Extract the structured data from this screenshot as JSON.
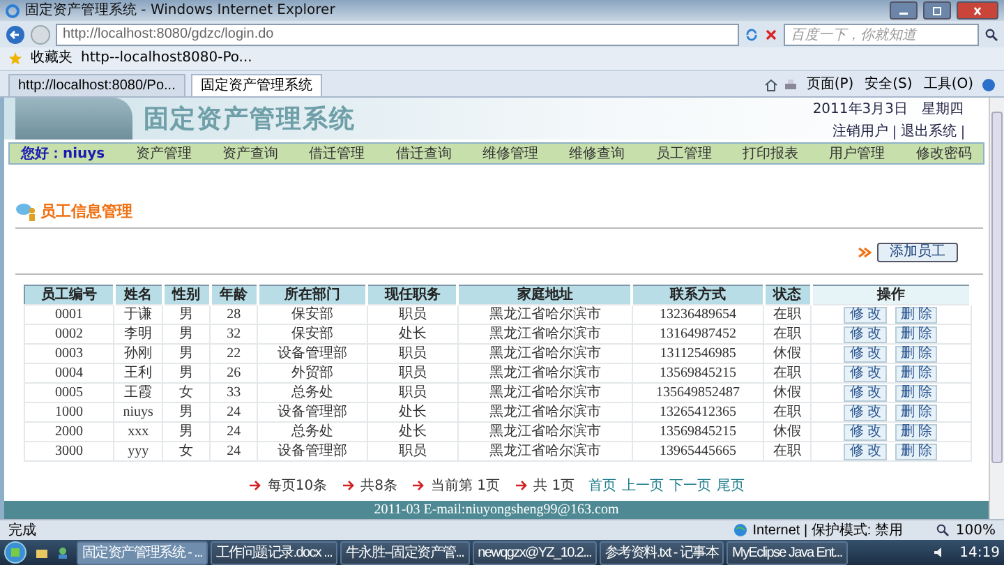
{
  "browser": {
    "title": "固定资产管理系统 - Windows Internet Explorer",
    "address": "http://localhost:8080/gdzc/login.do",
    "search_placeholder": "百度一下，你就知道",
    "favorites_label": "收藏夹",
    "favorite_link": "http--localhost8080-Po...",
    "tabs": [
      {
        "label": "http://localhost:8080/Po...",
        "selected": false
      },
      {
        "label": "固定资产管理系统",
        "selected": true
      }
    ],
    "commands": [
      "页面(P)",
      "安全(S)",
      "工具(O)"
    ]
  },
  "header": {
    "title": "固定资产管理系统",
    "date": "2011年3月3日",
    "weekday": "星期四",
    "links": [
      "注销用户",
      "退出系统"
    ]
  },
  "nav": {
    "greeting": "您好：",
    "user": "niuys",
    "items": [
      "资产管理",
      "资产查询",
      "借迁管理",
      "借迁查询",
      "维修管理",
      "维修查询",
      "员工管理",
      "打印报表",
      "用户管理",
      "修改密码"
    ]
  },
  "section_title": "员工信息管理",
  "add_button": "添加员工",
  "table": {
    "columns": [
      "员工编号",
      "姓名",
      "性别",
      "年龄",
      "所在部门",
      "现任职务",
      "家庭地址",
      "联系方式",
      "状态",
      "操作"
    ],
    "rows": [
      {
        "cells": [
          "0001",
          "于谦",
          "男",
          "28",
          "保安部",
          "职员",
          "黑龙江省哈尔滨市",
          "13236489654",
          "在职"
        ],
        "actions": [
          "修 改",
          "删 除"
        ]
      },
      {
        "cells": [
          "0002",
          "李明",
          "男",
          "32",
          "保安部",
          "处长",
          "黑龙江省哈尔滨市",
          "13164987452",
          "在职"
        ],
        "actions": [
          "修 改",
          "删 除"
        ]
      },
      {
        "cells": [
          "0003",
          "孙刚",
          "男",
          "22",
          "设备管理部",
          "职员",
          "黑龙江省哈尔滨市",
          "13112546985",
          "休假"
        ],
        "actions": [
          "修 改",
          "删 除"
        ]
      },
      {
        "cells": [
          "0004",
          "王利",
          "男",
          "26",
          "外贸部",
          "职员",
          "黑龙江省哈尔滨市",
          "13569845215",
          "在职"
        ],
        "actions": [
          "修 改",
          "删 除"
        ]
      },
      {
        "cells": [
          "0005",
          "王霞",
          "女",
          "33",
          "总务处",
          "职员",
          "黑龙江省哈尔滨市",
          "135649852487",
          "休假"
        ],
        "actions": [
          "修 改",
          "删 除"
        ]
      },
      {
        "cells": [
          "1000",
          "niuys",
          "男",
          "24",
          "设备管理部",
          "处长",
          "黑龙江省哈尔滨市",
          "13265412365",
          "在职"
        ],
        "actions": [
          "修 改",
          "删 除"
        ]
      },
      {
        "cells": [
          "2000",
          "xxx",
          "男",
          "24",
          "总务处",
          "处长",
          "黑龙江省哈尔滨市",
          "13569845215",
          "休假"
        ],
        "actions": [
          "修 改",
          "删 除"
        ]
      },
      {
        "cells": [
          "3000",
          "yyy",
          "女",
          "24",
          "设备管理部",
          "职员",
          "黑龙江省哈尔滨市",
          "13965445665",
          "在职"
        ],
        "actions": [
          "修 改",
          "删 除"
        ]
      }
    ]
  },
  "pager": {
    "info": [
      "每页10条",
      "共8条",
      "当前第 1页",
      "共 1页"
    ],
    "links": [
      "首页",
      "上一页",
      "下一页",
      "尾页"
    ]
  },
  "footer": "2011-03 E-mail:niuyongsheng99@163.com",
  "status": {
    "text": "完成",
    "zone": "Internet | 保护模式: 禁用",
    "zoom": "100%"
  },
  "taskbar": {
    "apps": [
      {
        "label": "固定资产管理系统 - ...",
        "selected": true
      },
      {
        "label": "工作问题记录.docx ...",
        "selected": false
      },
      {
        "label": "牛永胜--固定资产管...",
        "selected": false
      },
      {
        "label": "newqgzx@YZ_10.2...",
        "selected": false
      },
      {
        "label": "参考资料.txt - 记事本",
        "selected": false
      },
      {
        "label": "MyEclipse Java Ent...",
        "selected": false
      }
    ],
    "time": "14:19"
  }
}
